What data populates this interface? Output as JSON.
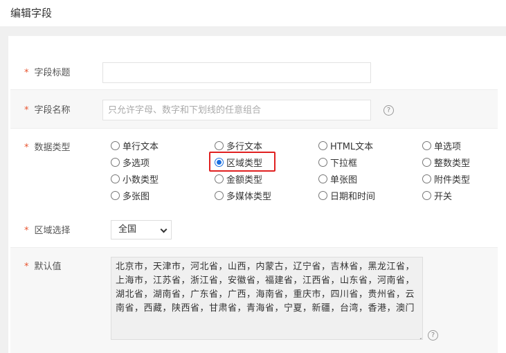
{
  "header": {
    "title": "编辑字段"
  },
  "fields": {
    "field_title": {
      "label": "字段标题",
      "value": ""
    },
    "field_name": {
      "label": "字段名称",
      "placeholder": "只允许字母、数字和下划线的任意组合"
    },
    "data_type": {
      "label": "数据类型",
      "selected": "区域类型",
      "options": [
        "单行文本",
        "多行文本",
        "HTML文本",
        "单选项",
        "多选项",
        "区域类型",
        "下拉框",
        "整数类型",
        "小数类型",
        "金额类型",
        "单张图",
        "附件类型",
        "多张图",
        "多媒体类型",
        "日期和时间",
        "开关"
      ]
    },
    "region_select": {
      "label": "区域选择",
      "value": "全国"
    },
    "default_value": {
      "label": "默认值",
      "value": "北京市，天津市，河北省，山西，内蒙古，辽宁省，吉林省，黑龙江省，上海市，江苏省，浙江省，安徽省，福建省，江西省，山东省，河南省，湖北省，湖南省，广东省，广西，海南省，重庆市，四川省，贵州省，云南省，西藏，陕西省，甘肃省，青海省，宁夏，新疆，台湾，香港，澳门"
    }
  },
  "help_symbol": "?",
  "required_mark": "*"
}
